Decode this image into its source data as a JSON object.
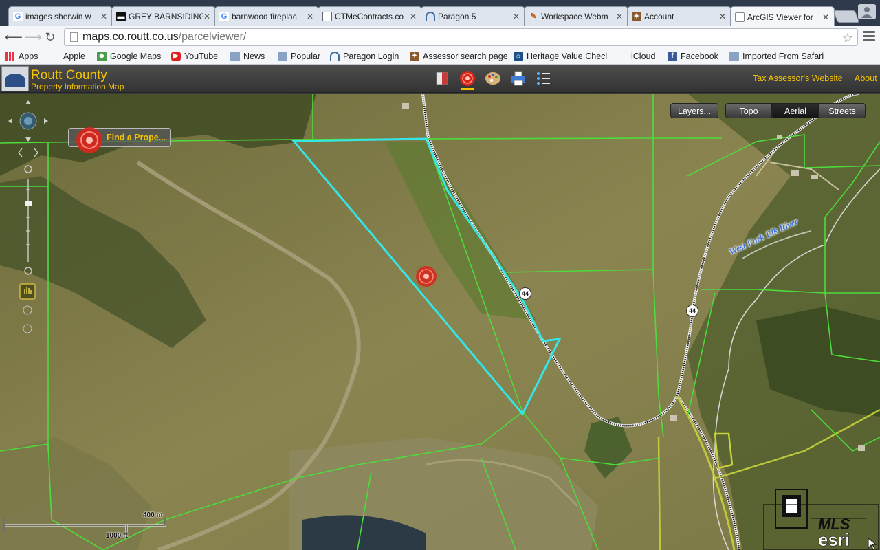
{
  "browser": {
    "tabs": [
      {
        "title": "images sherwin w",
        "icon": "google-icon"
      },
      {
        "title": "GREY BARNSIDING",
        "icon": "barn-site-icon"
      },
      {
        "title": "barnwood fireplac",
        "icon": "google-icon"
      },
      {
        "title": "CTMeContracts.co",
        "icon": "document-icon"
      },
      {
        "title": "Paragon 5",
        "icon": "paragon-icon"
      },
      {
        "title": "Workspace Webm",
        "icon": "workspace-icon"
      },
      {
        "title": "Account",
        "icon": "account-icon"
      },
      {
        "title": "ArcGIS Viewer for",
        "icon": "page-icon",
        "active": true
      }
    ],
    "url_domain": "maps.co.routt.co.us",
    "url_path": "/parcelviewer/",
    "bookmarks": [
      {
        "label": "Apps",
        "icon": "apps-grid-icon"
      },
      {
        "label": "Apple",
        "icon": "apple-icon"
      },
      {
        "label": "Google Maps",
        "icon": "google-maps-icon"
      },
      {
        "label": "YouTube",
        "icon": "youtube-icon"
      },
      {
        "label": "News",
        "icon": "folder-icon"
      },
      {
        "label": "Popular",
        "icon": "folder-icon"
      },
      {
        "label": "Paragon Login",
        "icon": "paragon-icon"
      },
      {
        "label": "Assessor search page",
        "icon": "map-icon"
      },
      {
        "label": "Heritage Value Checl",
        "icon": "heritage-icon"
      },
      {
        "label": "iCloud",
        "icon": "apple-icon"
      },
      {
        "label": "Facebook",
        "icon": "facebook-icon"
      },
      {
        "label": "Imported From Safari",
        "icon": "folder-icon"
      }
    ]
  },
  "app": {
    "title": "Routt County",
    "subtitle": "Property Information Map",
    "links": {
      "tax_assessor": "Tax Assessor's Website",
      "about": "About"
    },
    "accent": "#f3c400"
  },
  "map": {
    "layers_button": "Layers...",
    "basemaps": [
      "Topo",
      "Aerial",
      "Streets"
    ],
    "selected_basemap": "Aerial",
    "find_property": "Find a Prope...",
    "river_label": "West Fork Elk River",
    "route_shields": [
      "44",
      "44"
    ],
    "scale": {
      "metric": "400 m",
      "imperial": "1000 ft"
    },
    "parcel_color": "#35e6e6",
    "parcel_line_color": "#4ddc3c"
  }
}
